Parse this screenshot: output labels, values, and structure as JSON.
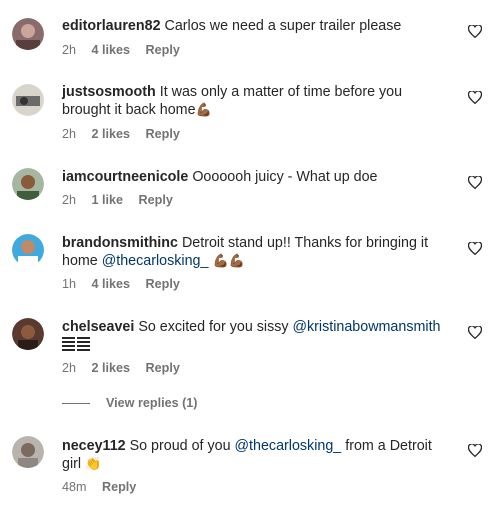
{
  "colors": {
    "username": "#262626",
    "meta": "#737373",
    "mention": "#00376b"
  },
  "icons": {
    "like": "heart-outline-icon"
  },
  "comments": [
    {
      "username": "editorlauren82",
      "text": "Carlos we need a super trailer please",
      "time": "2h",
      "likes": "4 likes",
      "reply": "Reply"
    },
    {
      "username": "justsosmooth",
      "text": "It was only a matter of time before you brought it back home",
      "emoji": "💪🏾",
      "time": "2h",
      "likes": "2 likes",
      "reply": "Reply"
    },
    {
      "username": "iamcourtneenicole",
      "text": "Ooooooh juicy - What up doe",
      "time": "2h",
      "likes": "1 like",
      "reply": "Reply"
    },
    {
      "username": "brandonsmithinc",
      "text": "Detroit stand up!! Thanks for bringing it home",
      "mention": "@thecarlosking_",
      "emoji": "💪🏾💪🏾",
      "time": "1h",
      "likes": "4 likes",
      "reply": "Reply"
    },
    {
      "username": "chelseavei",
      "text": "So excited for you sissy",
      "mention": "@kristinabowmansmith",
      "time": "2h",
      "likes": "2 likes",
      "reply": "Reply",
      "view_replies": "View replies (1)"
    },
    {
      "username": "necey112",
      "text": "So proud of you",
      "mention": "@thecarlosking_",
      "text_after": "from a Detroit girl",
      "emoji": "👏",
      "time": "48m",
      "reply": "Reply"
    }
  ]
}
